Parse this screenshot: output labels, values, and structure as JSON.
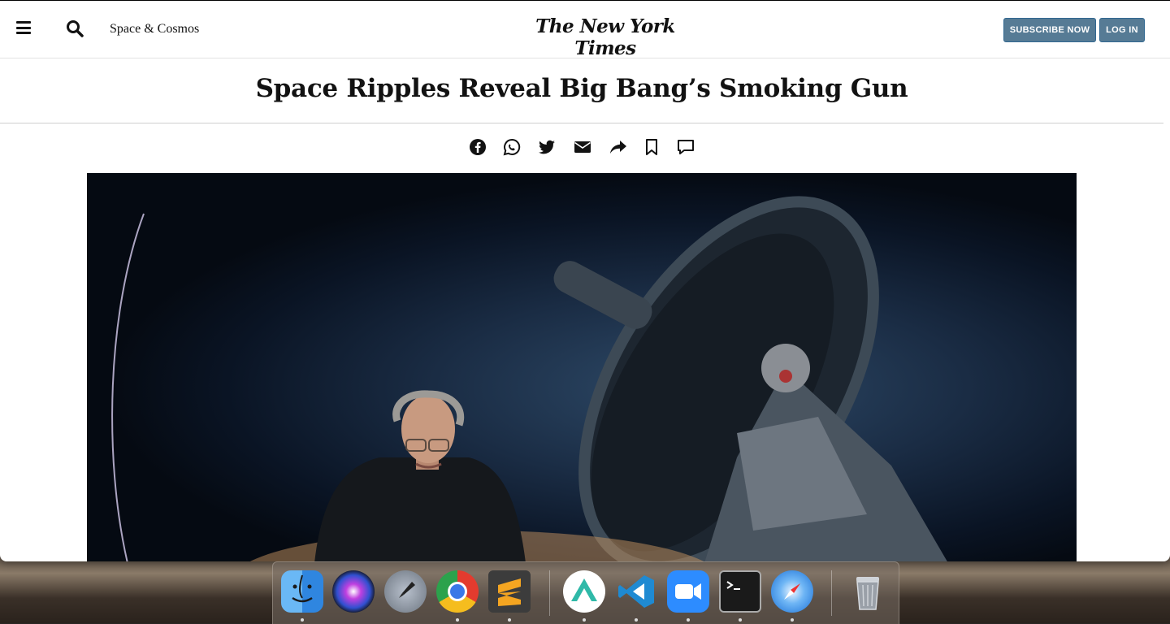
{
  "masthead": {
    "section_label": "Space & Cosmos",
    "logo_text": "The New York Times",
    "subscribe_label": "SUBSCRIBE NOW",
    "login_label": "LOG IN"
  },
  "article": {
    "headline": "Space Ripples Reveal Big Bang’s Smoking Gun"
  },
  "share_bar": {
    "icons": [
      "facebook-icon",
      "whatsapp-icon",
      "twitter-icon",
      "email-icon",
      "share-icon",
      "bookmark-icon",
      "comment-icon"
    ]
  },
  "hero_image": {
    "subject": "man-with-telescope-photo"
  },
  "dock": {
    "apps": [
      "finder",
      "siri",
      "launchpad",
      "chrome",
      "sublime-text",
      "nordvpn",
      "vscode",
      "zoom",
      "terminal",
      "safari",
      "trash"
    ]
  },
  "colors": {
    "button_bg": "#567b95",
    "text": "#121212"
  }
}
